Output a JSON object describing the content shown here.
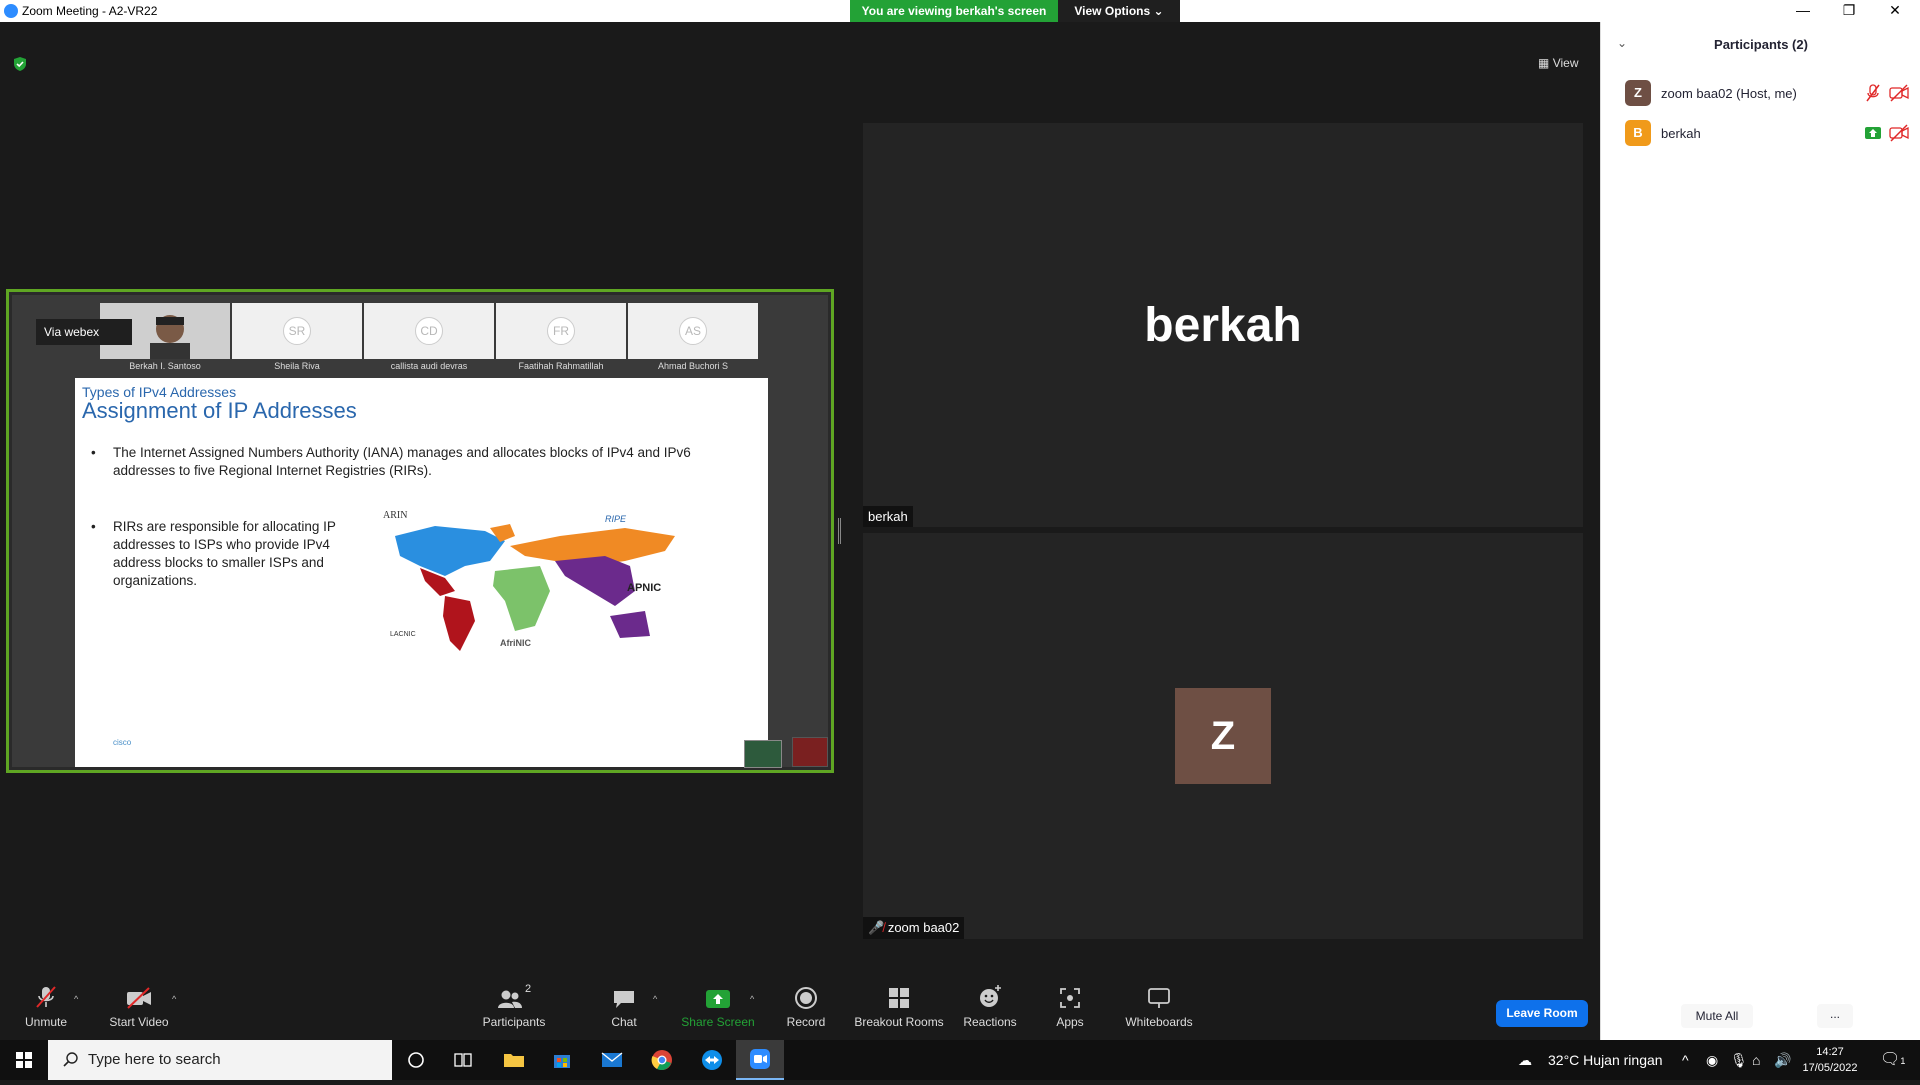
{
  "window": {
    "title": "Zoom Meeting - A2-VR22",
    "viewing_banner": "You are viewing berkah's screen",
    "view_options": "View Options"
  },
  "stage": {
    "view_label": "View"
  },
  "shared_screen": {
    "webex_logo": "Via  webex",
    "tiles": [
      {
        "initials": "",
        "name": "Berkah I. Santoso"
      },
      {
        "initials": "SR",
        "name": "Sheila Riva"
      },
      {
        "initials": "CD",
        "name": "callista audi devras"
      },
      {
        "initials": "FR",
        "name": "Faatihah Rahmatillah"
      },
      {
        "initials": "AS",
        "name": "Ahmad Buchori S"
      }
    ],
    "slide": {
      "subtitle": "Types of IPv4 Addresses",
      "title": "Assignment of IP Addresses",
      "bullet1": "The Internet Assigned Numbers Authority (IANA) manages and allocates blocks of IPv4 and IPv6 addresses to five Regional Internet Registries (RIRs).",
      "bullet2": "RIRs are responsible for allocating IP addresses to ISPs who provide IPv4 address blocks to smaller ISPs and organizations.",
      "map_labels": {
        "arin": "ARIN",
        "ripe": "RIPE",
        "apnic": "APNIC",
        "lacnic": "LACNIC",
        "afrinic": "AfriNIC"
      },
      "cisco_logo": "cisco"
    }
  },
  "tiles": {
    "berkah": {
      "big_name": "berkah",
      "label": "berkah"
    },
    "zoom": {
      "avatar": "Z",
      "label": "zoom baa02"
    }
  },
  "toolbar": {
    "unmute": "Unmute",
    "start_video": "Start Video",
    "participants": "Participants",
    "participants_count": "2",
    "chat": "Chat",
    "share_screen": "Share Screen",
    "record": "Record",
    "breakout_rooms": "Breakout Rooms",
    "reactions": "Reactions",
    "apps": "Apps",
    "whiteboards": "Whiteboards",
    "leave_room": "Leave Room",
    "share_color": "#23a236"
  },
  "participants_panel": {
    "title": "Participants (2)",
    "participants": [
      {
        "initial": "Z",
        "name": "zoom baa02 (Host, me)",
        "color": "#6e4f44"
      },
      {
        "initial": "B",
        "name": "berkah",
        "color": "#f09a1a"
      }
    ],
    "mute_all": "Mute All",
    "more": "..."
  },
  "taskbar": {
    "search_placeholder": "Type here to search",
    "weather": "32°C  Hujan ringan",
    "time": "14:27",
    "date": "17/05/2022",
    "notification_count": "1"
  }
}
